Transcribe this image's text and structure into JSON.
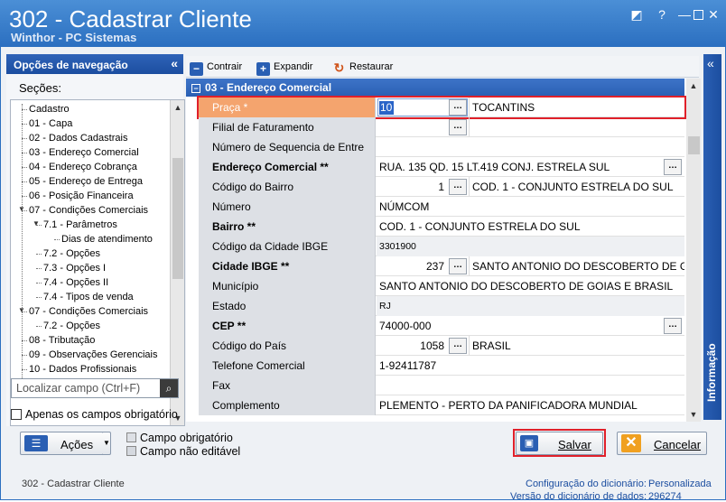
{
  "window": {
    "title": "302 - Cadastrar Cliente",
    "subtitle": "Winthor - PC Sistemas"
  },
  "nav": {
    "header": "Opções de navegação",
    "secoes_label": "Seções:",
    "items": [
      {
        "label": "Cadastro",
        "level": 0
      },
      {
        "label": "01 - Capa",
        "level": 0
      },
      {
        "label": "02 - Dados Cadastrais",
        "level": 0
      },
      {
        "label": "03 - Endereço Comercial",
        "level": 0
      },
      {
        "label": "04 - Endereço Cobrança",
        "level": 0
      },
      {
        "label": "05 - Endereço de Entrega",
        "level": 0
      },
      {
        "label": "06 - Posição Financeira",
        "level": 0
      },
      {
        "label": "07 - Condições Comerciais",
        "level": 0
      },
      {
        "label": "7.1 - Parâmetros",
        "level": 1
      },
      {
        "label": "Dias de atendimento",
        "level": 2
      },
      {
        "label": "7.2 - Opções",
        "level": 1
      },
      {
        "label": "7.3 - Opções I",
        "level": 1
      },
      {
        "label": "7.4 - Opções II",
        "level": 1
      },
      {
        "label": "7.4 - Tipos de venda",
        "level": 1
      },
      {
        "label": "07 - Condições Comerciais",
        "level": 0
      },
      {
        "label": "7.2 - Opções",
        "level": 1
      },
      {
        "label": "08 - Tributação",
        "level": 0
      },
      {
        "label": "09 - Observações Gerenciais",
        "level": 0
      },
      {
        "label": "10 - Dados Profissionais",
        "level": 0
      }
    ],
    "search_placeholder": "Localizar campo (Ctrl+F)",
    "only_required_label": "Apenas os campos obrigatório"
  },
  "toolbar": {
    "contrair": "Contrair",
    "expandir": "Expandir",
    "restaurar": "Restaurar"
  },
  "section_title": "03 - Endereço Comercial",
  "fields": [
    {
      "label": "Praça *",
      "value": "10",
      "extra": "TOCANTINS",
      "bold": false,
      "ellipsis": true,
      "highlight": true
    },
    {
      "label": "Filial de Faturamento",
      "value": "",
      "extra": "",
      "bold": false,
      "ellipsis": true
    },
    {
      "label": "Número de Sequencia de Entre",
      "value": "",
      "bold": false
    },
    {
      "label": "Endereço Comercial **",
      "value": "RUA. 135 QD. 15 LT.419 CONJ. ESTRELA SUL",
      "bold": true,
      "ellipsis_right": true
    },
    {
      "label": "Código do Bairro",
      "value": "1",
      "extra": "COD. 1 - CONJUNTO ESTRELA DO SUL",
      "bold": false,
      "ellipsis": true
    },
    {
      "label": "Número",
      "value": "NÚMCOM",
      "bold": false
    },
    {
      "label": "Bairro **",
      "value": "COD. 1 - CONJUNTO ESTRELA DO SUL",
      "bold": true
    },
    {
      "label": "Código da Cidade IBGE",
      "value": "3301900",
      "bold": false,
      "readonly": true
    },
    {
      "label": "Cidade IBGE **",
      "value": "237",
      "extra": "SANTO ANTONIO DO DESCOBERTO DE G",
      "bold": true,
      "ellipsis": true
    },
    {
      "label": "Município",
      "value": "SANTO ANTONIO DO DESCOBERTO DE GOIAS E BRASIL",
      "bold": false
    },
    {
      "label": "Estado",
      "value": "RJ",
      "bold": false,
      "readonly": true
    },
    {
      "label": "CEP **",
      "value": "74000-000",
      "bold": true,
      "ellipsis_right": true
    },
    {
      "label": "Código do País",
      "value": "1058",
      "extra": "BRASIL",
      "bold": false,
      "ellipsis": true
    },
    {
      "label": "Telefone Comercial",
      "value": "1-92411787",
      "bold": false
    },
    {
      "label": "Fax",
      "value": "",
      "bold": false
    },
    {
      "label": "Complemento",
      "value": "PLEMENTO - PERTO DA PANIFICADORA MUNDIAL",
      "bold": false
    }
  ],
  "info_label": "Informação",
  "buttons": {
    "acoes": "Ações",
    "salvar": "Salvar",
    "cancelar": "Cancelar"
  },
  "legend": {
    "required": "Campo obrigatório",
    "not_editable": "Campo não editável"
  },
  "status": {
    "left": "302 - Cadastrar Cliente",
    "config_label": "Configuração do dicionário:",
    "config_value": "Personalizada",
    "version_label": "Versão do dicionário de dados:",
    "version_value": "296274"
  },
  "colors": {
    "accent": "#2a5fb3",
    "highlight_row": "#f4a46e",
    "highlight_border": "#e0202a",
    "link": "#1c4ea0"
  }
}
